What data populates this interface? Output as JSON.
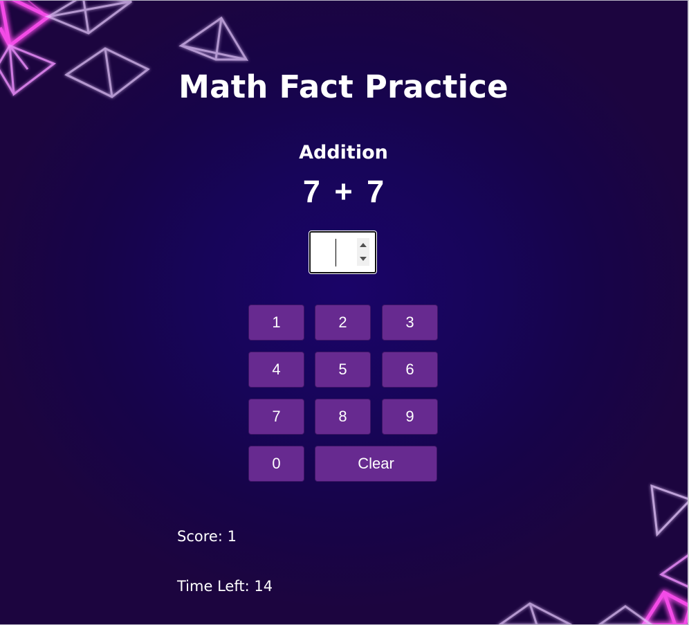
{
  "app": {
    "title": "Math Fact Practice"
  },
  "quiz": {
    "operation": "Addition",
    "operand_a": "7",
    "operator": "+",
    "operand_b": "7"
  },
  "answer_field": {
    "value": "",
    "placeholder": ""
  },
  "keypad": {
    "keys": [
      "1",
      "2",
      "3",
      "4",
      "5",
      "6",
      "7",
      "8",
      "9",
      "0"
    ],
    "clear_label": "Clear"
  },
  "status": {
    "score_label": "Score:",
    "score_value": "1",
    "time_label": "Time Left:",
    "time_value": "14"
  },
  "colors": {
    "background": "#170559",
    "key_fill": "#672a90",
    "neon_pink": "#ff3de6",
    "neon_outline": "#e8c6ff"
  },
  "icons": {
    "spinner_up": "chevron-up-icon",
    "spinner_down": "chevron-down-icon",
    "decoration": "neon-triangle-icon"
  }
}
